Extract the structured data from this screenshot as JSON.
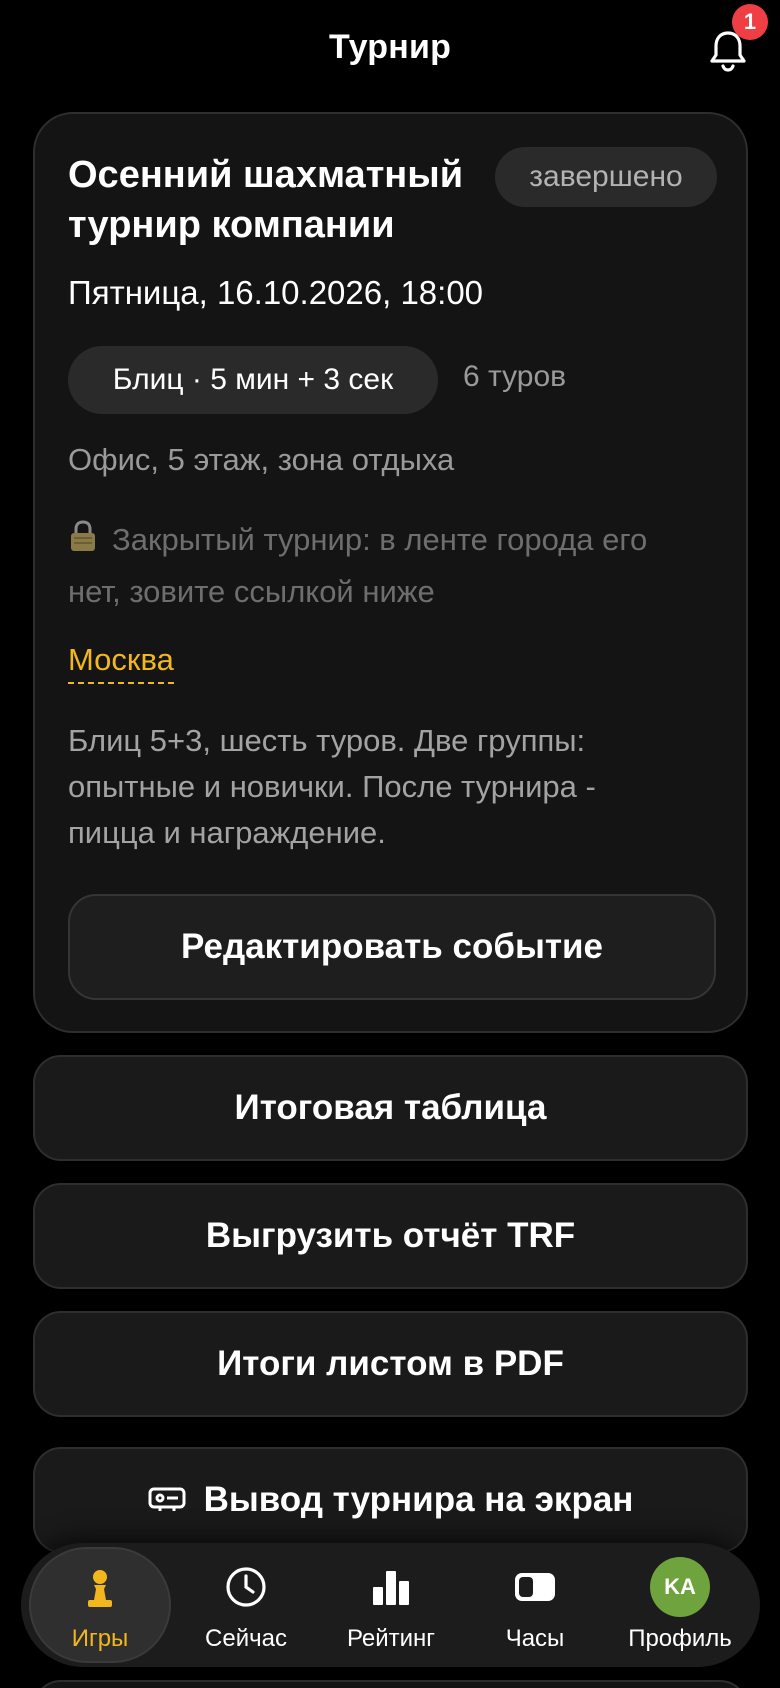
{
  "header": {
    "title": "Турнир",
    "notification_count": "1"
  },
  "event": {
    "title": "Осенний шахматный турнир компании",
    "status": "завершено",
    "date": "Пятница, 16.10.2026, 18:00",
    "format": "Блиц · 5 мин + 3 сек",
    "rounds": "6 туров",
    "location": "Офис, 5 этаж, зона отдыха",
    "private_note": "Закрытый турнир: в ленте города его нет, зовите ссылкой ниже",
    "city": "Москва",
    "description": "Блиц 5+3, шесть туров. Две группы: опытные и новички. После турнира - пицца и награждение.",
    "edit_label": "Редактировать событие"
  },
  "actions": {
    "results_label": "Итоговая таблица",
    "trf_label": "Выгрузить отчёт TRF",
    "pdf_label": "Итоги листом в PDF",
    "screen_label": "Вывод турнира на экран"
  },
  "tabbar": {
    "games": "Игры",
    "now": "Сейчас",
    "rating": "Рейтинг",
    "clock": "Часы",
    "profile": "Профиль",
    "avatar_initials": "KA"
  },
  "colors": {
    "accent": "#f2b71c",
    "badge": "#ef3f45",
    "avatar": "#6ea33d",
    "background": "#000000",
    "card": "#141414"
  },
  "icons": [
    "bell-icon",
    "lock-icon",
    "screen-icon",
    "pawn-icon",
    "clock-icon",
    "bar-chart-icon",
    "chess-clock-icon"
  ]
}
